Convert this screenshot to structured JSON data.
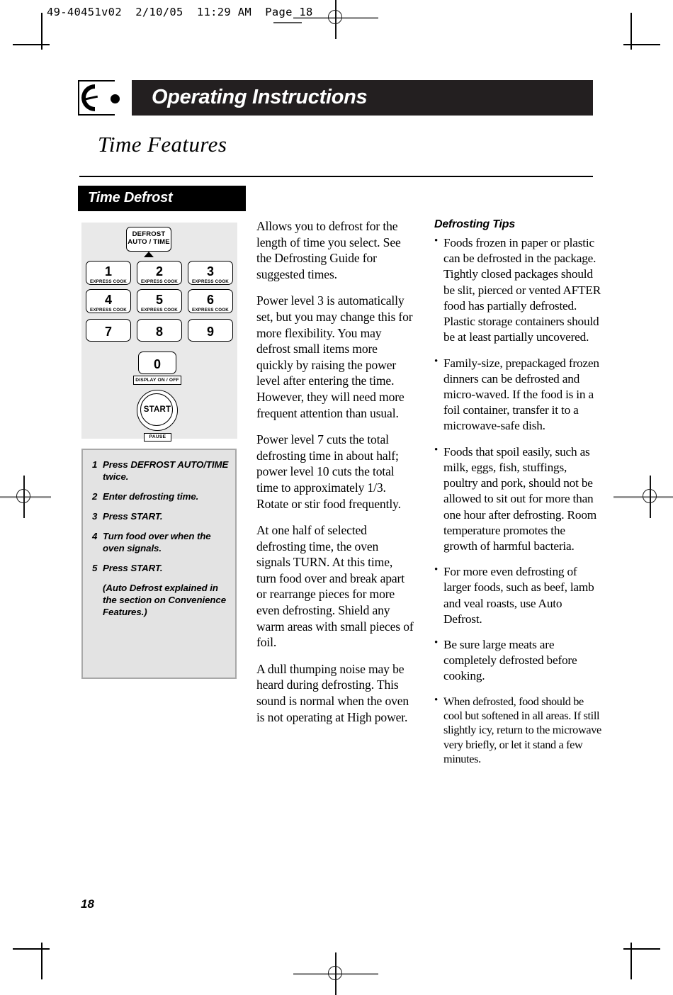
{
  "scan": {
    "header_line": "49-40451v02  2/10/05  11:29 AM  Page 18"
  },
  "header": {
    "icon_name": "dial-knob-icon",
    "title": "Operating Instructions"
  },
  "section": {
    "title": "Time Features",
    "subhead": "Time Defrost"
  },
  "keypad": {
    "defrost_key": {
      "line1": "DEFROST",
      "line2": "AUTO / TIME"
    },
    "keys": [
      {
        "num": "1",
        "sub": "EXPRESS COOK"
      },
      {
        "num": "2",
        "sub": "EXPRESS COOK"
      },
      {
        "num": "3",
        "sub": "EXPRESS COOK"
      },
      {
        "num": "4",
        "sub": "EXPRESS COOK"
      },
      {
        "num": "5",
        "sub": "EXPRESS COOK"
      },
      {
        "num": "6",
        "sub": "EXPRESS COOK"
      },
      {
        "num": "7",
        "sub": ""
      },
      {
        "num": "8",
        "sub": ""
      },
      {
        "num": "9",
        "sub": ""
      }
    ],
    "zero_key": {
      "num": "0",
      "sub": ""
    },
    "display_label": "DISPLAY ON / OFF",
    "start_label": "START",
    "pause_label": "PAUSE"
  },
  "steps": {
    "items": [
      {
        "n": "1",
        "text": "Press DEFROST AUTO/TIME twice."
      },
      {
        "n": "2",
        "text": "Enter defrosting time."
      },
      {
        "n": "3",
        "text": "Press START."
      },
      {
        "n": "4",
        "text": "Turn food over when the oven signals."
      },
      {
        "n": "5",
        "text": "Press START."
      }
    ],
    "note": "(Auto Defrost explained in the section on Convenience Features.)"
  },
  "body": {
    "paragraphs": [
      "Allows you to defrost for the length of time you select. See the Defrosting Guide for suggested times.",
      "Power level 3 is automatically set, but you may change this for more flexibility. You may defrost small items more quickly by raising the power level after entering the time. However, they will need more frequent attention than usual.",
      "Power level 7 cuts the total defrosting time in about half; power level 10 cuts the total time to approximately 1/3. Rotate or stir food frequently.",
      "At one half of selected defrosting time, the oven signals TURN. At this time, turn food over and break apart or rearrange pieces for more even defrosting. Shield any warm areas with small pieces of foil.",
      "A dull thumping noise may be heard during defrosting. This sound is normal when the oven is not operating at High power."
    ]
  },
  "tips": {
    "heading": "Defrosting Tips",
    "bullet_glyph": "•",
    "items": [
      "Foods frozen in paper or plastic can be defrosted in the package. Tightly closed packages should be slit, pierced or vented AFTER food has partially defrosted. Plastic storage containers should be at least partially uncovered.",
      "Family-size, prepackaged frozen dinners can be defrosted and micro-waved. If the food is in a foil container, transfer it to a microwave-safe dish.",
      "Foods that spoil easily, such as milk, eggs, fish, stuffings, poultry and pork, should not be allowed to sit out for more than one hour after defrosting. Room temperature promotes the growth of harmful bacteria.",
      "For more even defrosting of larger foods, such as beef, lamb and veal roasts, use Auto Defrost.",
      "Be sure large meats are completely defrosted before cooking.",
      "When defrosted, food should be cool but softened in all areas. If still slightly icy, return to the microwave very briefly, or let it stand a few minutes."
    ]
  },
  "footer": {
    "page_number": "18"
  }
}
